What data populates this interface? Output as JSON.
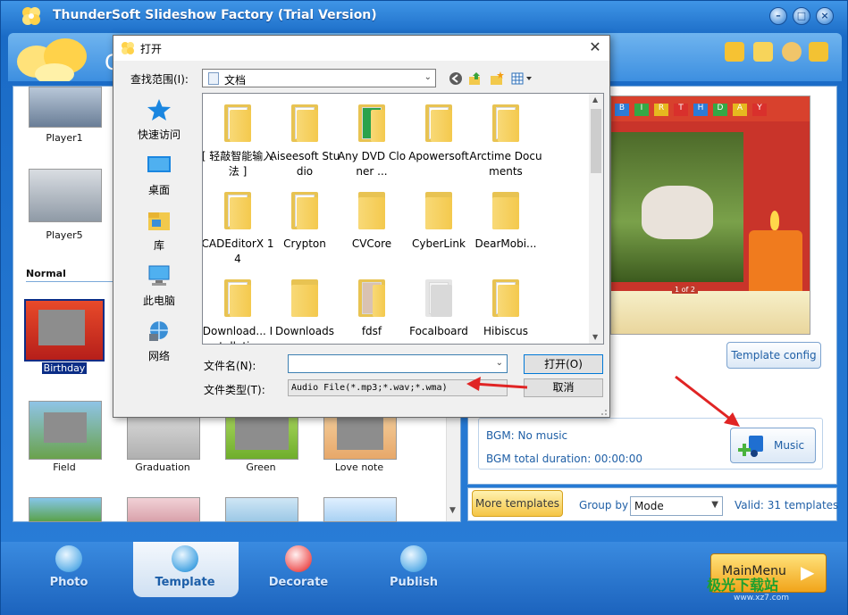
{
  "window": {
    "title": "ThunderSoft Slideshow Factory (Trial Version)",
    "minimize_icon": "minimize-icon",
    "restore_icon": "restore-icon",
    "close_icon": "close-icon"
  },
  "header": {
    "page_initial": "C"
  },
  "templates": {
    "top_items": [
      {
        "label": "Player1"
      },
      {
        "label": "Player5"
      }
    ],
    "section_label": "Normal",
    "normal_items": [
      {
        "label": "Birthday",
        "selected": true
      },
      {
        "label": "Field"
      },
      {
        "label": "Graduation"
      },
      {
        "label": "Green"
      },
      {
        "label": "Love note"
      }
    ]
  },
  "preview": {
    "banner_letters": [
      "B",
      "I",
      "R",
      "T",
      "H",
      "D",
      "A",
      "Y"
    ],
    "page_indicator": "1 of 2"
  },
  "buttons": {
    "template_config": "Template config",
    "music": "Music",
    "more_templates": "More templates",
    "main_menu": "MainMenu"
  },
  "music": {
    "bgm": "BGM: No music",
    "bgm_duration": "BGM total duration: 00:00:00"
  },
  "group_by": {
    "label": "Group by",
    "value": "Mode",
    "valid": "Valid: 31 templates"
  },
  "nav": {
    "tabs": [
      {
        "label": "Photo"
      },
      {
        "label": "Template",
        "active": true
      },
      {
        "label": "Decorate"
      },
      {
        "label": "Publish"
      }
    ]
  },
  "watermark": {
    "text": "极光下载站",
    "url": "www.xz7.com"
  },
  "dialog": {
    "title": "打开",
    "look_in_label": "查找范围(I):",
    "look_in_value": "文档",
    "places": [
      {
        "label": "快速访问",
        "icon": "star-icon"
      },
      {
        "label": "桌面",
        "icon": "desktop-icon"
      },
      {
        "label": "库",
        "icon": "library-icon"
      },
      {
        "label": "此电脑",
        "icon": "computer-icon"
      },
      {
        "label": "网络",
        "icon": "network-icon"
      }
    ],
    "files": [
      {
        "label": "[ 轻敲智能输入法 ]"
      },
      {
        "label": "Aiseesoft Studio"
      },
      {
        "label": "Any DVD Cloner ..."
      },
      {
        "label": "Apowersoft"
      },
      {
        "label": "Arctime Documents"
      },
      {
        "label": "CADEditorX 14"
      },
      {
        "label": "Crypton"
      },
      {
        "label": "CVCore"
      },
      {
        "label": "CyberLink"
      },
      {
        "label": "DearMobi..."
      },
      {
        "label": "Download... Installations"
      },
      {
        "label": "Downloads"
      },
      {
        "label": "fdsf"
      },
      {
        "label": "Focalboard"
      },
      {
        "label": "Hibiscus"
      }
    ],
    "filename_label": "文件名(N):",
    "filename_value": "",
    "filetype_label": "文件类型(T):",
    "filetype_value": "Audio File(*.mp3;*.wav;*.wma)",
    "open_button": "打开(O)",
    "cancel_button": "取消"
  }
}
